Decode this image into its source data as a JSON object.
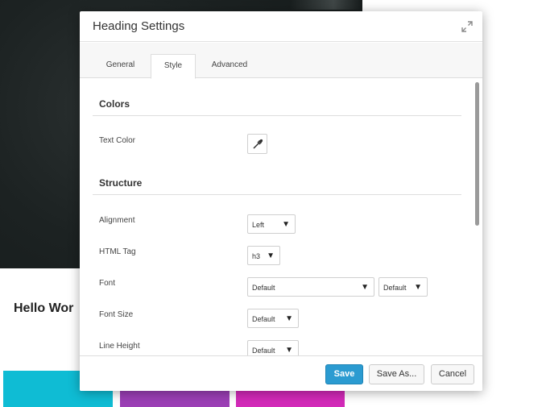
{
  "background": {
    "heading_text": "Hello Wor",
    "swatch_colors": [
      "#0fbcd4",
      "#9b3fb5",
      "#d22ab8"
    ]
  },
  "dialog": {
    "title": "Heading Settings",
    "expand_icon": "expand-icon",
    "tabs": [
      {
        "label": "General",
        "active": false
      },
      {
        "label": "Style",
        "active": true
      },
      {
        "label": "Advanced",
        "active": false
      }
    ],
    "sections": {
      "colors": {
        "title": "Colors",
        "text_color_label": "Text Color",
        "picker_icon": "eyedropper-icon"
      },
      "structure": {
        "title": "Structure",
        "alignment": {
          "label": "Alignment",
          "value": "Left"
        },
        "html_tag": {
          "label": "HTML Tag",
          "value": "h3"
        },
        "font": {
          "label": "Font",
          "family_value": "Default",
          "weight_value": "Default"
        },
        "font_size": {
          "label": "Font Size",
          "value": "Default"
        },
        "line_height": {
          "label": "Line Height",
          "value": "Default"
        }
      }
    },
    "footer": {
      "save_label": "Save",
      "save_as_label": "Save As...",
      "cancel_label": "Cancel"
    },
    "accent_color": "#2b9bd1"
  }
}
